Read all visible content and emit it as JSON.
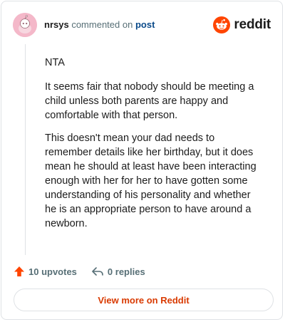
{
  "comment": {
    "author": "nrsys",
    "action_text": "commented on",
    "post_link": "post",
    "paragraphs": [
      "NTA",
      "It seems fair that nobody should be meeting a child unless both parents are happy and comfortable with that person.",
      "This doesn't mean your dad needs to remember details like her birthday, but it does mean he should at least have been interacting enough with her for her to have gotten some understanding of his personality and whether he is an appropriate person to have around a newborn."
    ]
  },
  "brand": {
    "name": "reddit",
    "icon": "reddit-logo-icon",
    "color": "#ff4500"
  },
  "actions": {
    "upvotes_label": "10 upvotes",
    "replies_label": "0 replies",
    "upvote_icon": "upvote-arrow-icon",
    "reply_icon": "reply-arrow-icon"
  },
  "footer": {
    "view_more_label": "View more on Reddit"
  },
  "colors": {
    "accent": "#d93a00",
    "upvote": "#ff4500",
    "link": "#0a4a8a",
    "muted": "#576f76",
    "avatar_bg": "#f4b8c9"
  }
}
